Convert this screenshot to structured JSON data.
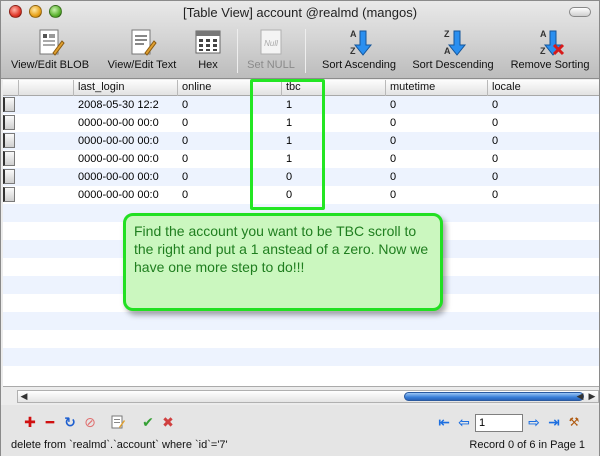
{
  "window": {
    "title": "[Table View] account @realmd (mangos)"
  },
  "toolbar": {
    "view_edit_blob": "View/Edit BLOB",
    "view_edit_text": "View/Edit Text",
    "hex": "Hex",
    "set_null": "Set NULL",
    "sort_ascending": "Sort Ascending",
    "sort_descending": "Sort Descending",
    "remove_sorting": "Remove Sorting",
    "null_badge": "Null"
  },
  "table": {
    "columns": [
      "last_login",
      "online",
      "tbc",
      "mutetime",
      "locale"
    ],
    "rows": [
      [
        "2008-05-30 12:2",
        "0",
        "1",
        "0",
        "0"
      ],
      [
        "0000-00-00 00:0",
        "0",
        "1",
        "0",
        "0"
      ],
      [
        "0000-00-00 00:0",
        "0",
        "1",
        "0",
        "0"
      ],
      [
        "0000-00-00 00:0",
        "0",
        "1",
        "0",
        "0"
      ],
      [
        "0000-00-00 00:0",
        "0",
        "0",
        "0",
        "0"
      ],
      [
        "0000-00-00 00:0",
        "0",
        "0",
        "0",
        "0"
      ]
    ]
  },
  "annotation": {
    "text": "Find the account you want to be TBC scroll to the right and put a 1 anstead of a zero.  Now we have one more step to do!!!"
  },
  "footer": {
    "page_value": "1",
    "status_text": "delete from `realmd`.`account` where `id`='7'",
    "record_text": "Record 0 of 6 in Page 1"
  },
  "colors": {
    "highlight": "#23e623",
    "row_stripe": "#edf3fe",
    "callout_text": "#1f7e1f"
  }
}
